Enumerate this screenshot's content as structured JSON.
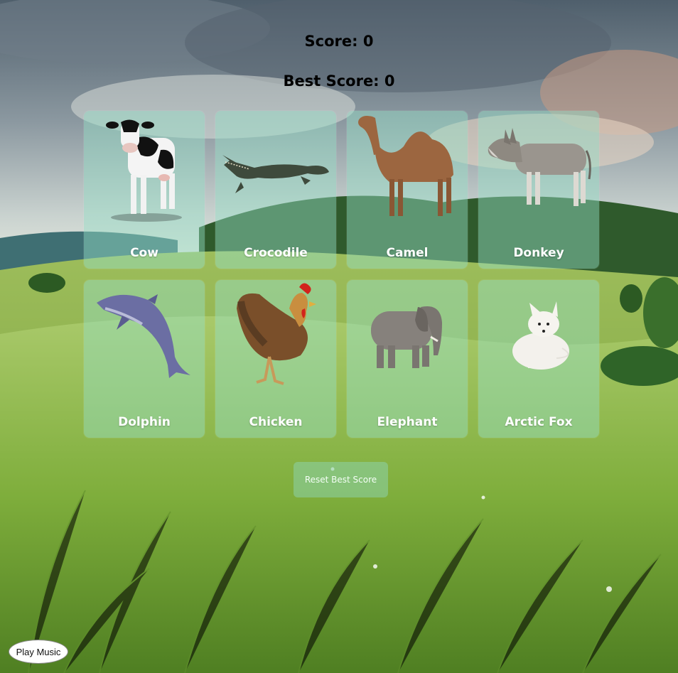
{
  "header": {
    "score_text": "Score: 0",
    "best_score_text": "Best Score: 0"
  },
  "cards": [
    {
      "label": "Cow",
      "icon": "cow-icon"
    },
    {
      "label": "Crocodile",
      "icon": "crocodile-icon"
    },
    {
      "label": "Camel",
      "icon": "camel-icon"
    },
    {
      "label": "Donkey",
      "icon": "donkey-icon"
    },
    {
      "label": "Dolphin",
      "icon": "dolphin-icon"
    },
    {
      "label": "Chicken",
      "icon": "chicken-icon"
    },
    {
      "label": "Elephant",
      "icon": "elephant-icon"
    },
    {
      "label": "Arctic Fox",
      "icon": "arctic-fox-icon"
    }
  ],
  "controls": {
    "reset_label": "Reset Best Score",
    "music_label": "Play Music"
  },
  "colors": {
    "card_tint": "#96e1c8",
    "sky_top": "#5a6e7e",
    "grass": "#7fae3c"
  }
}
